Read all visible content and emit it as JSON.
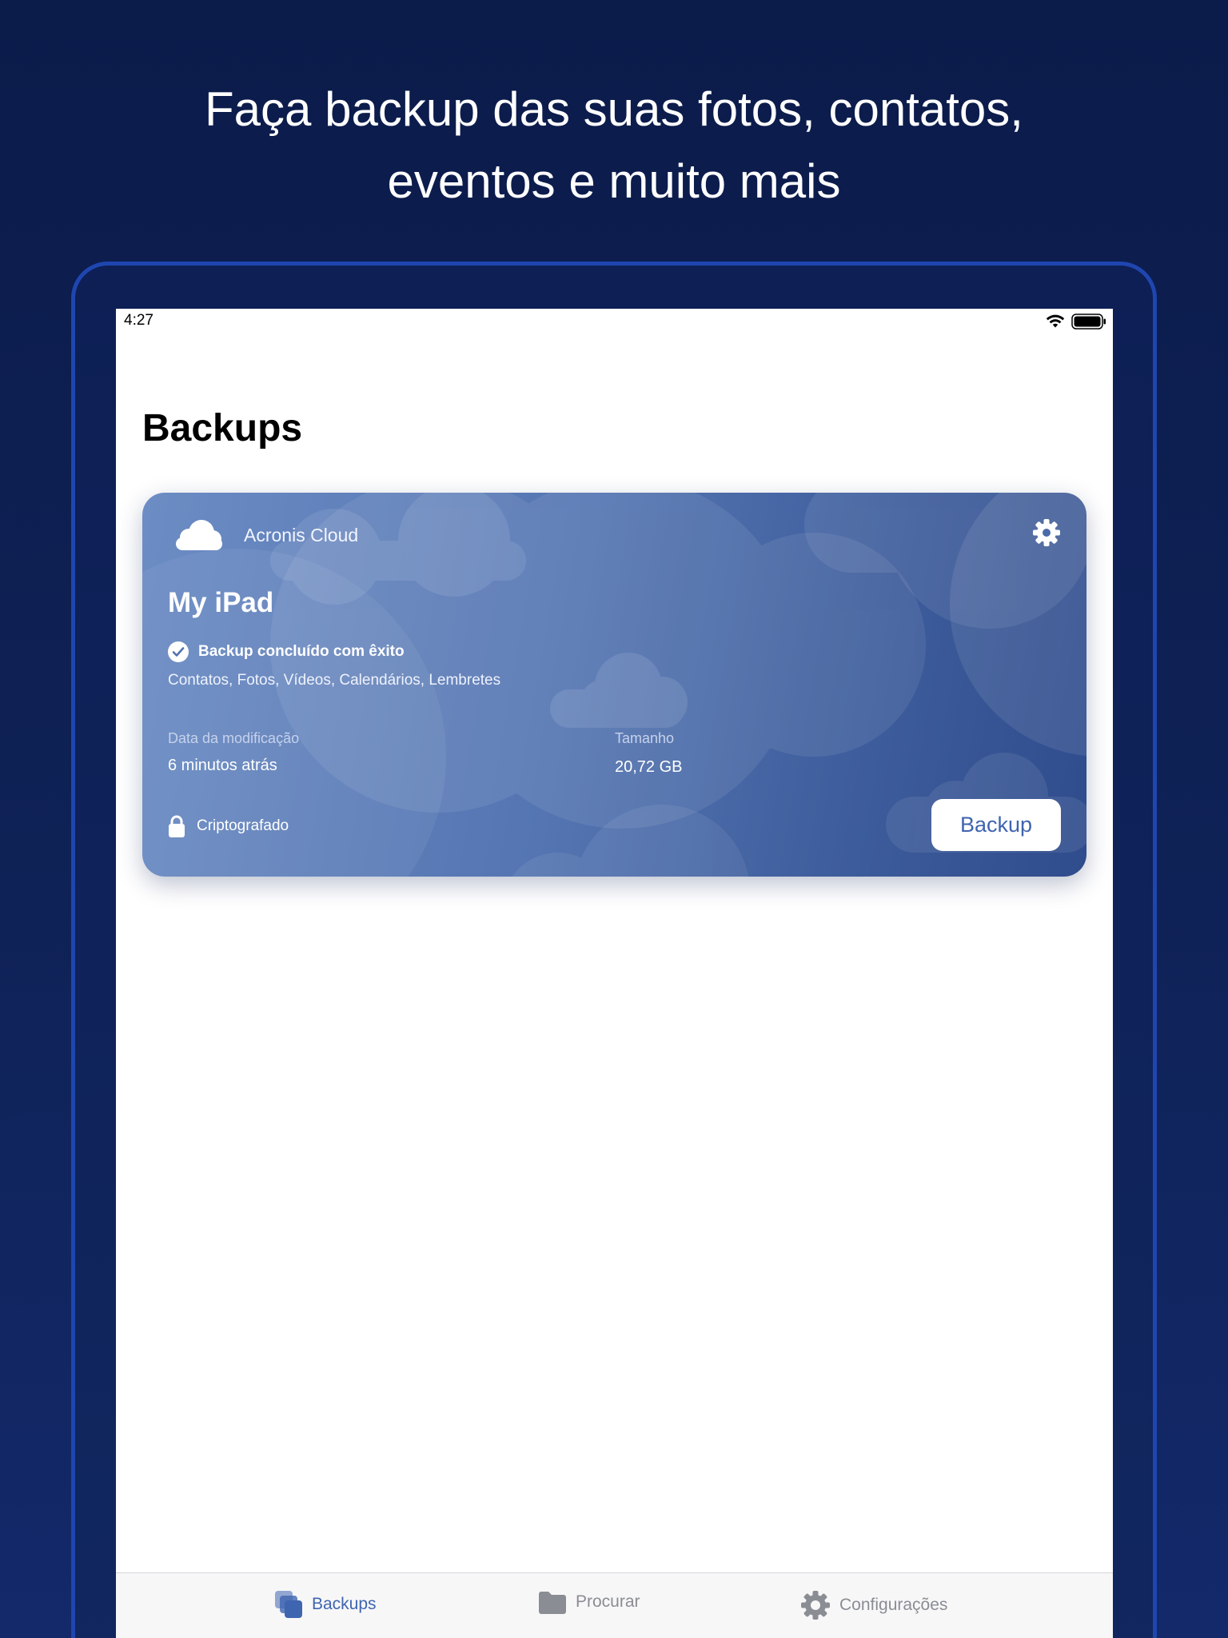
{
  "headline": {
    "line1": "Faça backup das suas fotos, contatos,",
    "line2": "eventos e muito mais"
  },
  "status_bar": {
    "time": "4:27",
    "icons": [
      "wifi-icon",
      "battery-icon"
    ]
  },
  "page": {
    "title": "Backups"
  },
  "card": {
    "provider_icon": "cloud-icon",
    "provider": "Acronis Cloud",
    "settings_icon": "gear-icon",
    "device_name": "My iPad",
    "status_icon": "check-circle-icon",
    "status": "Backup concluído com êxito",
    "categories": "Contatos, Fotos, Vídeos, Calendários, Lembretes",
    "modified_label": "Data da modificação",
    "modified_value": "6 minutos atrás",
    "size_label": "Tamanho",
    "size_value": "20,72 GB",
    "lock_icon": "lock-icon",
    "encryption": "Criptografado",
    "backup_button": "Backup"
  },
  "tab_bar": {
    "tabs": [
      {
        "label": "Backups",
        "icon": "backups-stack-icon",
        "active": true
      },
      {
        "label": "Procurar",
        "icon": "folder-icon",
        "active": false
      },
      {
        "label": "Configurações",
        "icon": "gear-icon",
        "active": false
      }
    ]
  },
  "colors": {
    "background": "#0f2257",
    "device_frame": "#1f46b0",
    "card_start": "#6c8cc4",
    "card_end": "#2f4c8c",
    "accent": "#3f65b0",
    "tab_inactive": "#8a8d93"
  }
}
